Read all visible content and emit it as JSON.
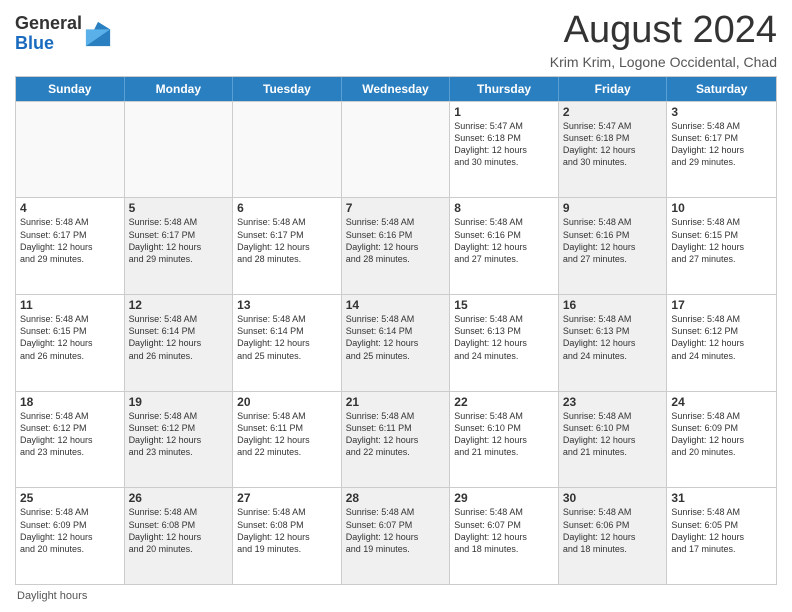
{
  "header": {
    "logo_general": "General",
    "logo_blue": "Blue",
    "month_title": "August 2024",
    "location": "Krim Krim, Logone Occidental, Chad"
  },
  "days_of_week": [
    "Sunday",
    "Monday",
    "Tuesday",
    "Wednesday",
    "Thursday",
    "Friday",
    "Saturday"
  ],
  "weeks": [
    [
      {
        "day": "",
        "info": "",
        "empty": true
      },
      {
        "day": "",
        "info": "",
        "empty": true
      },
      {
        "day": "",
        "info": "",
        "empty": true
      },
      {
        "day": "",
        "info": "",
        "empty": true
      },
      {
        "day": "1",
        "info": "Sunrise: 5:47 AM\nSunset: 6:18 PM\nDaylight: 12 hours\nand 30 minutes."
      },
      {
        "day": "2",
        "info": "Sunrise: 5:47 AM\nSunset: 6:18 PM\nDaylight: 12 hours\nand 30 minutes.",
        "shaded": true
      },
      {
        "day": "3",
        "info": "Sunrise: 5:48 AM\nSunset: 6:17 PM\nDaylight: 12 hours\nand 29 minutes."
      }
    ],
    [
      {
        "day": "4",
        "info": "Sunrise: 5:48 AM\nSunset: 6:17 PM\nDaylight: 12 hours\nand 29 minutes."
      },
      {
        "day": "5",
        "info": "Sunrise: 5:48 AM\nSunset: 6:17 PM\nDaylight: 12 hours\nand 29 minutes.",
        "shaded": true
      },
      {
        "day": "6",
        "info": "Sunrise: 5:48 AM\nSunset: 6:17 PM\nDaylight: 12 hours\nand 28 minutes."
      },
      {
        "day": "7",
        "info": "Sunrise: 5:48 AM\nSunset: 6:16 PM\nDaylight: 12 hours\nand 28 minutes.",
        "shaded": true
      },
      {
        "day": "8",
        "info": "Sunrise: 5:48 AM\nSunset: 6:16 PM\nDaylight: 12 hours\nand 27 minutes."
      },
      {
        "day": "9",
        "info": "Sunrise: 5:48 AM\nSunset: 6:16 PM\nDaylight: 12 hours\nand 27 minutes.",
        "shaded": true
      },
      {
        "day": "10",
        "info": "Sunrise: 5:48 AM\nSunset: 6:15 PM\nDaylight: 12 hours\nand 27 minutes."
      }
    ],
    [
      {
        "day": "11",
        "info": "Sunrise: 5:48 AM\nSunset: 6:15 PM\nDaylight: 12 hours\nand 26 minutes."
      },
      {
        "day": "12",
        "info": "Sunrise: 5:48 AM\nSunset: 6:14 PM\nDaylight: 12 hours\nand 26 minutes.",
        "shaded": true
      },
      {
        "day": "13",
        "info": "Sunrise: 5:48 AM\nSunset: 6:14 PM\nDaylight: 12 hours\nand 25 minutes."
      },
      {
        "day": "14",
        "info": "Sunrise: 5:48 AM\nSunset: 6:14 PM\nDaylight: 12 hours\nand 25 minutes.",
        "shaded": true
      },
      {
        "day": "15",
        "info": "Sunrise: 5:48 AM\nSunset: 6:13 PM\nDaylight: 12 hours\nand 24 minutes."
      },
      {
        "day": "16",
        "info": "Sunrise: 5:48 AM\nSunset: 6:13 PM\nDaylight: 12 hours\nand 24 minutes.",
        "shaded": true
      },
      {
        "day": "17",
        "info": "Sunrise: 5:48 AM\nSunset: 6:12 PM\nDaylight: 12 hours\nand 24 minutes."
      }
    ],
    [
      {
        "day": "18",
        "info": "Sunrise: 5:48 AM\nSunset: 6:12 PM\nDaylight: 12 hours\nand 23 minutes."
      },
      {
        "day": "19",
        "info": "Sunrise: 5:48 AM\nSunset: 6:12 PM\nDaylight: 12 hours\nand 23 minutes.",
        "shaded": true
      },
      {
        "day": "20",
        "info": "Sunrise: 5:48 AM\nSunset: 6:11 PM\nDaylight: 12 hours\nand 22 minutes."
      },
      {
        "day": "21",
        "info": "Sunrise: 5:48 AM\nSunset: 6:11 PM\nDaylight: 12 hours\nand 22 minutes.",
        "shaded": true
      },
      {
        "day": "22",
        "info": "Sunrise: 5:48 AM\nSunset: 6:10 PM\nDaylight: 12 hours\nand 21 minutes."
      },
      {
        "day": "23",
        "info": "Sunrise: 5:48 AM\nSunset: 6:10 PM\nDaylight: 12 hours\nand 21 minutes.",
        "shaded": true
      },
      {
        "day": "24",
        "info": "Sunrise: 5:48 AM\nSunset: 6:09 PM\nDaylight: 12 hours\nand 20 minutes."
      }
    ],
    [
      {
        "day": "25",
        "info": "Sunrise: 5:48 AM\nSunset: 6:09 PM\nDaylight: 12 hours\nand 20 minutes."
      },
      {
        "day": "26",
        "info": "Sunrise: 5:48 AM\nSunset: 6:08 PM\nDaylight: 12 hours\nand 20 minutes.",
        "shaded": true
      },
      {
        "day": "27",
        "info": "Sunrise: 5:48 AM\nSunset: 6:08 PM\nDaylight: 12 hours\nand 19 minutes."
      },
      {
        "day": "28",
        "info": "Sunrise: 5:48 AM\nSunset: 6:07 PM\nDaylight: 12 hours\nand 19 minutes.",
        "shaded": true
      },
      {
        "day": "29",
        "info": "Sunrise: 5:48 AM\nSunset: 6:07 PM\nDaylight: 12 hours\nand 18 minutes."
      },
      {
        "day": "30",
        "info": "Sunrise: 5:48 AM\nSunset: 6:06 PM\nDaylight: 12 hours\nand 18 minutes.",
        "shaded": true
      },
      {
        "day": "31",
        "info": "Sunrise: 5:48 AM\nSunset: 6:05 PM\nDaylight: 12 hours\nand 17 minutes."
      }
    ]
  ],
  "footer": {
    "daylight_label": "Daylight hours"
  }
}
